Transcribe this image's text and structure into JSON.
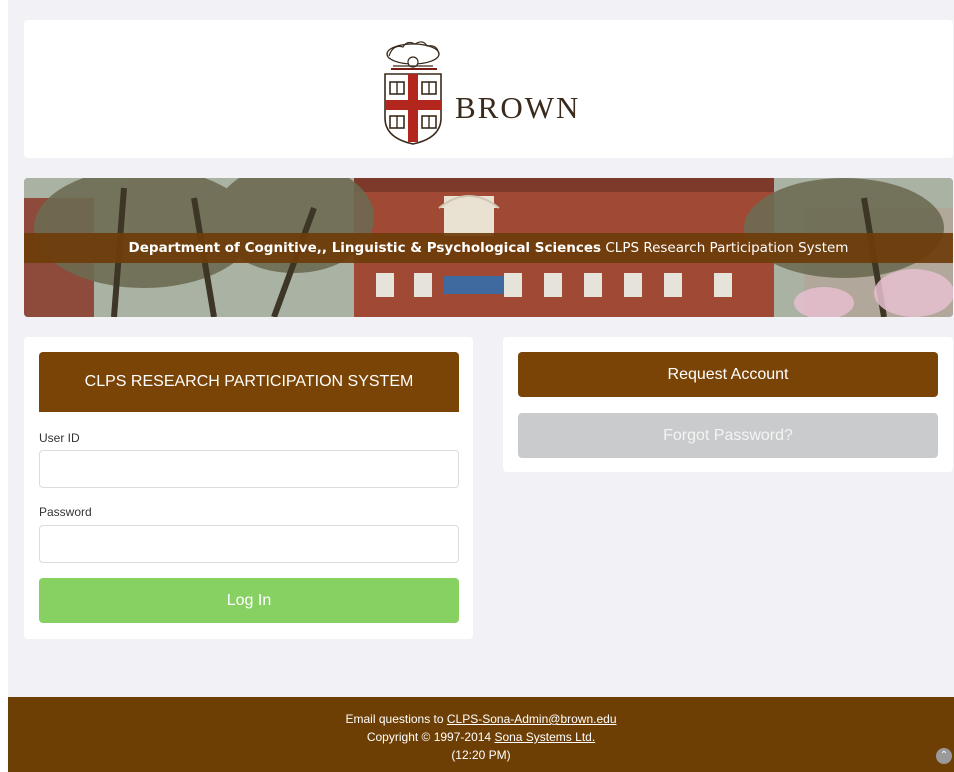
{
  "logo": {
    "wordmark": "BROWN",
    "icon": "brown-shield-icon"
  },
  "banner": {
    "department_bold": "Department of Cognitive,, Linguistic & Psychological Sciences",
    "system_name": "CLPS Research Participation System"
  },
  "login": {
    "header": "CLPS RESEARCH PARTICIPATION SYSTEM",
    "user_id_label": "User ID",
    "user_id_value": "",
    "password_label": "Password",
    "password_value": "",
    "login_button": "Log In"
  },
  "actions": {
    "request_account": "Request Account",
    "forgot_password": "Forgot Password?"
  },
  "footer": {
    "email_prefix": "Email questions to ",
    "email_link": "CLPS-Sona-Admin@brown.edu",
    "copyright_prefix": "Copyright © 1997-2014 ",
    "copyright_link": "Sona Systems Ltd.",
    "time": "(12:20 PM)",
    "scroll_icon": "chevron-up-icon"
  },
  "colors": {
    "brand_brown": "#7a4406",
    "footer_brown": "#6e3f05",
    "login_green": "#86d162",
    "disabled_gray": "#c9cbcc"
  }
}
